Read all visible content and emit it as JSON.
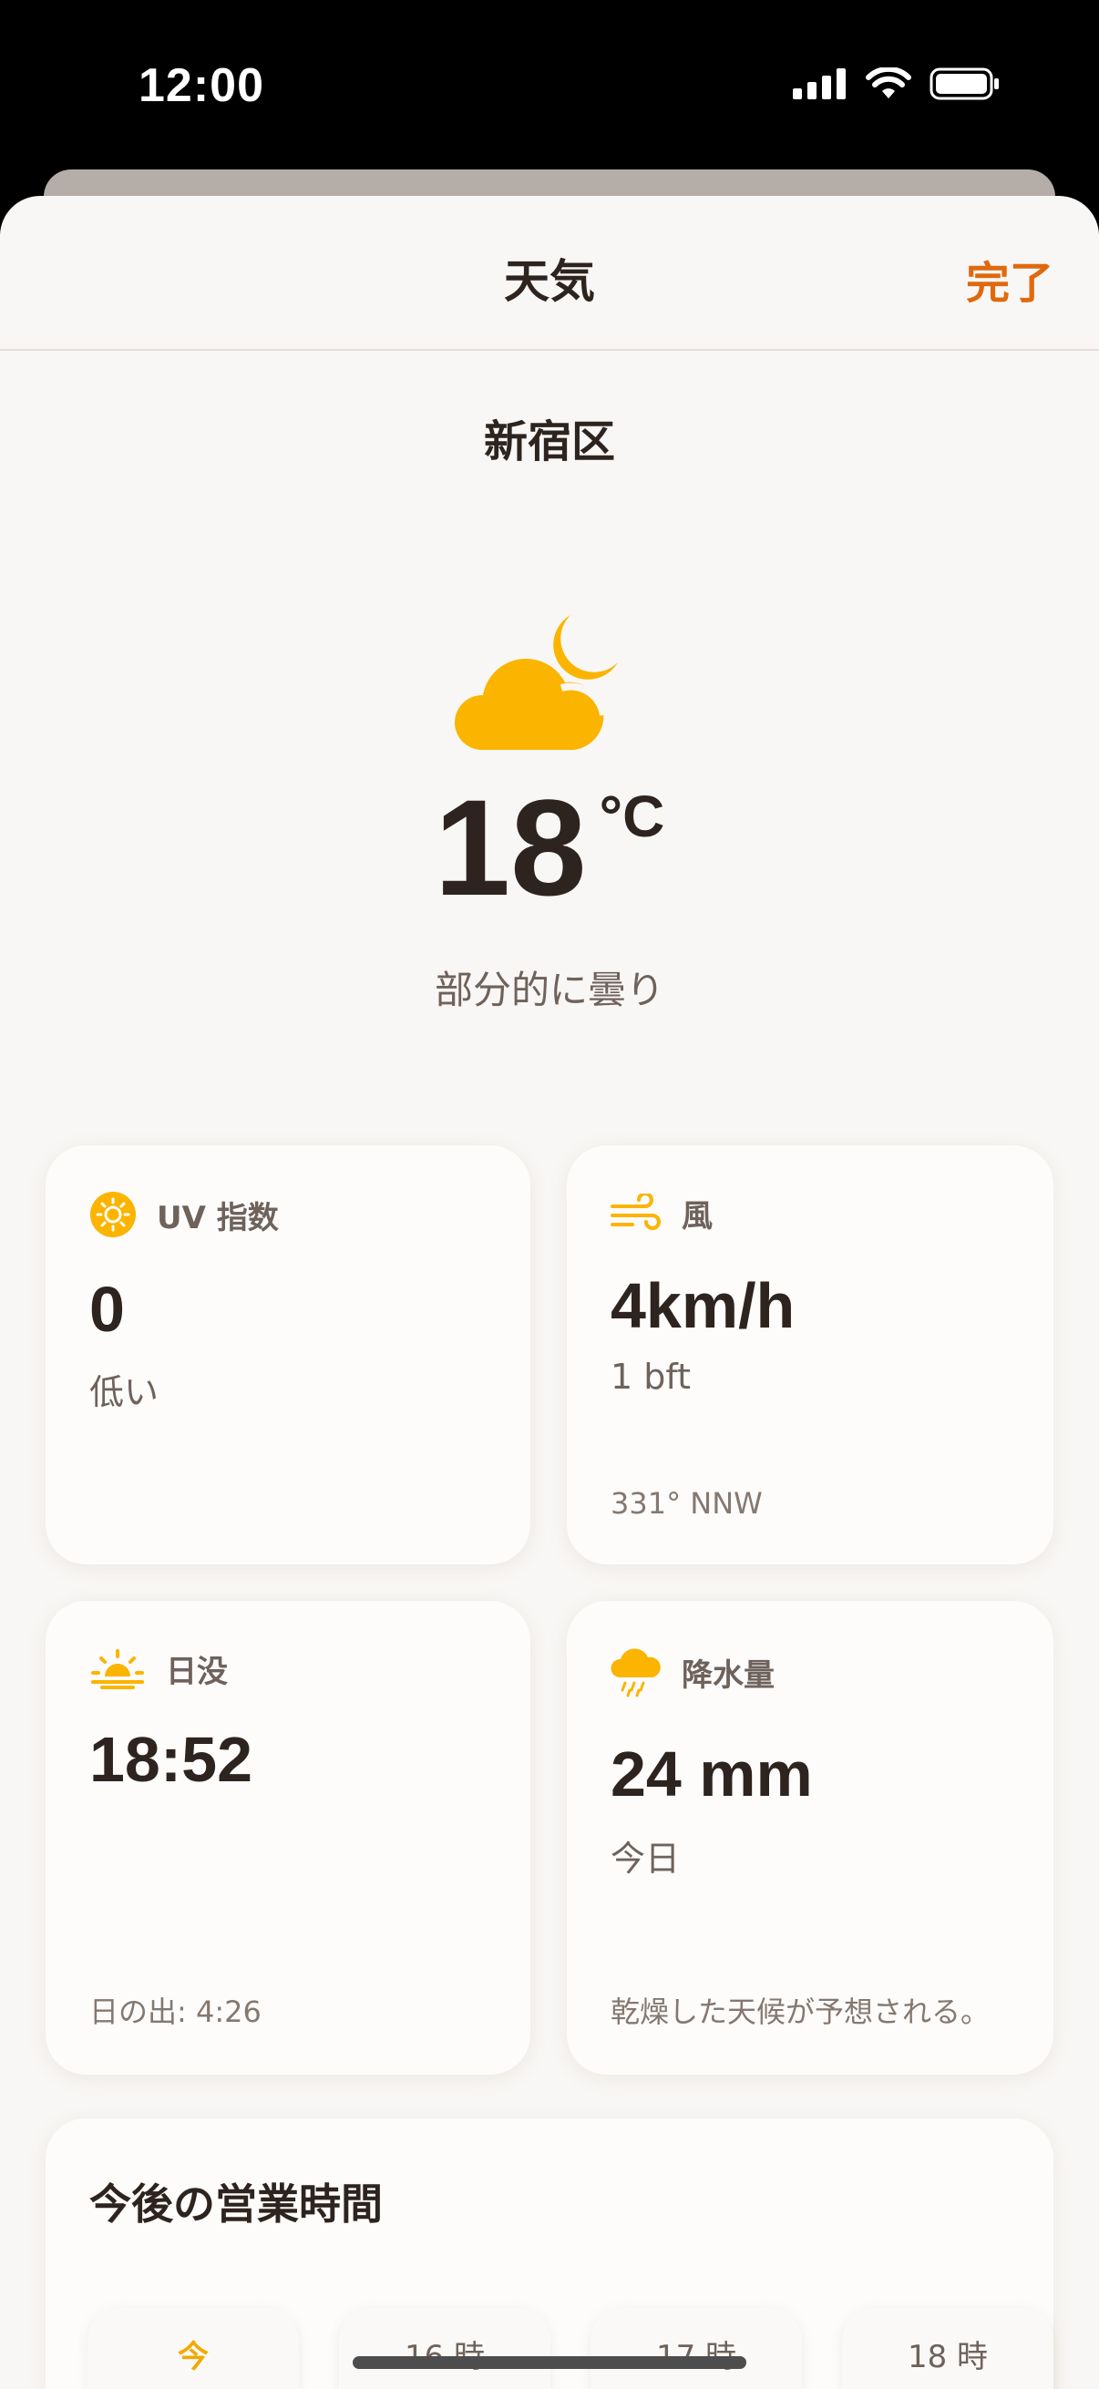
{
  "status_bar": {
    "time": "12:00",
    "icons": [
      "signal-icon",
      "wifi-icon",
      "battery-icon"
    ]
  },
  "nav": {
    "title": "天気",
    "done_label": "完了"
  },
  "location": "新宿区",
  "current": {
    "icon": "partly-cloudy-night-icon",
    "temperature": "18",
    "unit": "°C",
    "condition": "部分的に曇り"
  },
  "uv": {
    "icon": "sun-icon",
    "label": "UV 指数",
    "value": "0",
    "level": "低い"
  },
  "wind": {
    "icon": "wind-icon",
    "label": "風",
    "speed": "4km/h",
    "beaufort": "1 bft",
    "direction": "331° NNW"
  },
  "sunset": {
    "icon": "sunset-icon",
    "label": "日没",
    "time": "18:52",
    "sunrise": "日の出: 4:26"
  },
  "precipitation": {
    "icon": "rain-cloud-icon",
    "label": "降水量",
    "amount": "24 mm",
    "period": "今日",
    "note": "乾燥した天候が予想される。"
  },
  "hours": {
    "title": "今後の営業時間",
    "items": [
      {
        "label": "今",
        "now": true
      },
      {
        "label": "16 時"
      },
      {
        "label": "17 時"
      },
      {
        "label": "18 時"
      }
    ]
  },
  "colors": {
    "accent": "#e0690e",
    "icon_yellow": "#fbb400",
    "background": "#f9f7f5",
    "text": "#2e241f"
  }
}
